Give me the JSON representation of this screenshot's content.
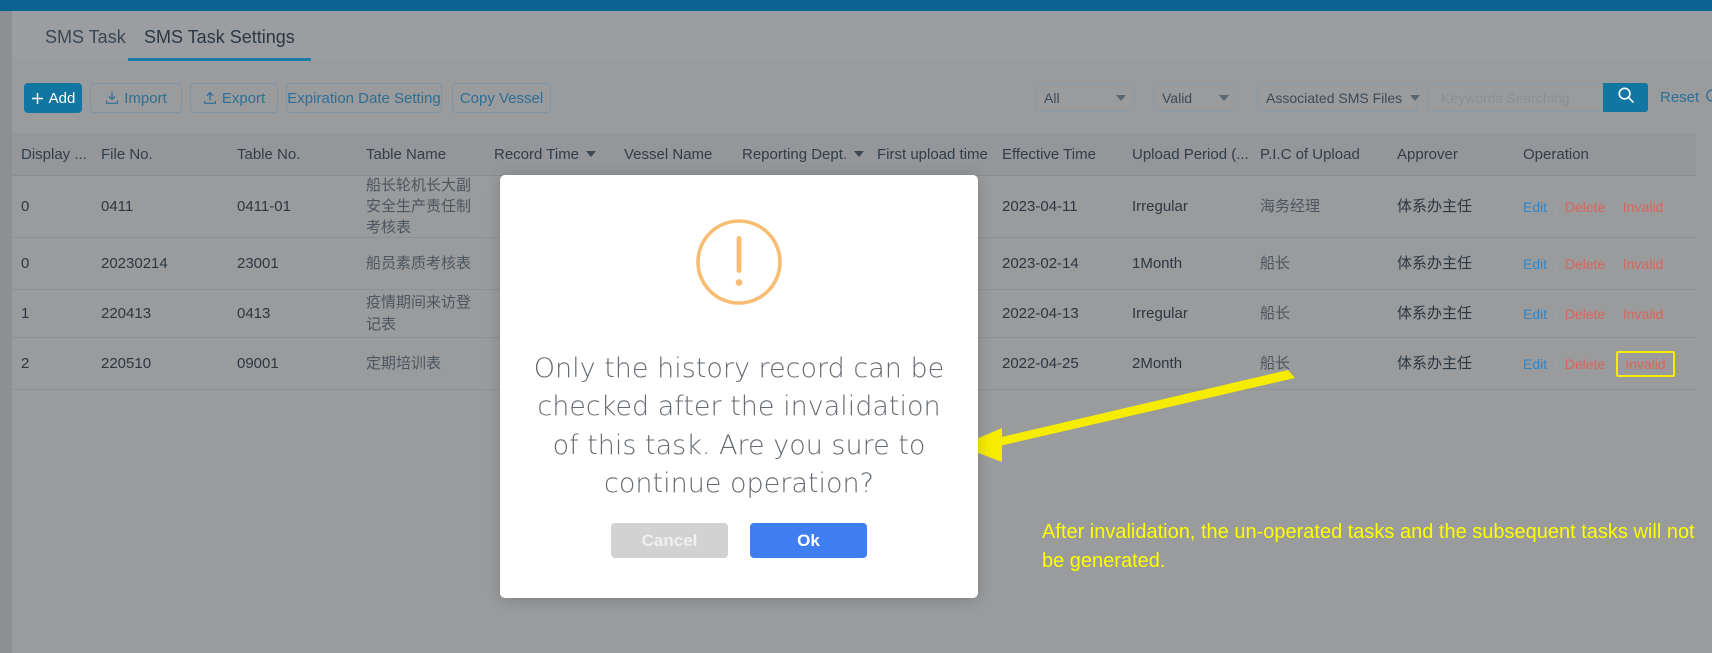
{
  "tabs": [
    {
      "label": "SMS Task",
      "active": false
    },
    {
      "label": "SMS Task Settings",
      "active": true
    }
  ],
  "toolbar": {
    "add_label": "Add",
    "import_label": "Import",
    "export_label": "Export",
    "expiration_label": "Expiration Date Setting",
    "copy_vessel_label": "Copy Vessel",
    "reset_label": "Reset"
  },
  "filters": {
    "scope": "All",
    "status": "Valid",
    "files": "Associated SMS Files"
  },
  "search": {
    "value": "",
    "placeholder": "Keywords Searching"
  },
  "table": {
    "columns": [
      "Display ...",
      "File No.",
      "Table No.",
      "Table Name",
      "Record Time",
      "Vessel Name",
      "Reporting Dept.",
      "First upload time",
      "Effective Time",
      "Upload Period (...",
      "P.I.C of Upload",
      "Approver",
      "Operation"
    ],
    "rows": [
      {
        "display": "0",
        "file_no": "0411",
        "table_no": "0411-01",
        "table_name": "船长轮机长大副安全生产责任制考核表",
        "record_time": "",
        "vessel_name": "",
        "reporting_dept": "",
        "first_upload_time": "",
        "effective_time": "2023-04-11",
        "upload_period": "Irregular",
        "pic_of_upload": "海务经理",
        "approver": "体系办主任",
        "operations": [
          "Edit",
          "Delete",
          "Invalid"
        ]
      },
      {
        "display": "0",
        "file_no": "20230214",
        "table_no": "23001",
        "table_name": "船员素质考核表",
        "record_time": "",
        "vessel_name": "",
        "reporting_dept": "",
        "first_upload_time": "",
        "effective_time": "2023-02-14",
        "upload_period": "1Month",
        "pic_of_upload": "船长",
        "approver": "体系办主任",
        "operations": [
          "Edit",
          "Delete",
          "Invalid"
        ]
      },
      {
        "display": "1",
        "file_no": "220413",
        "table_no": "0413",
        "table_name": "疫情期间来访登记表",
        "record_time": "",
        "vessel_name": "",
        "reporting_dept": "",
        "first_upload_time": "",
        "effective_time": "2022-04-13",
        "upload_period": "Irregular",
        "pic_of_upload": "船长",
        "approver": "体系办主任",
        "operations": [
          "Edit",
          "Delete",
          "Invalid"
        ]
      },
      {
        "display": "2",
        "file_no": "220510",
        "table_no": "09001",
        "table_name": "定期培训表",
        "record_time": "",
        "vessel_name": "",
        "reporting_dept": "",
        "first_upload_time": "",
        "effective_time": "2022-04-25",
        "upload_period": "2Month",
        "pic_of_upload": "船长",
        "approver": "体系办主任",
        "operations": [
          "Edit",
          "Delete",
          "Invalid"
        ],
        "highlight_operation": "Invalid"
      }
    ]
  },
  "modal": {
    "icon": "warning-exclamation-circle-icon",
    "message": "Only the history record can be checked after the invalidation of this task. Are you sure to continue operation?",
    "cancel_label": "Cancel",
    "ok_label": "Ok"
  },
  "annotation": {
    "text": "After invalidation, the un-operated tasks and the subsequent tasks will not be generated.",
    "color": "#ffff00"
  },
  "colors": {
    "accent_blue": "#1276a3",
    "top_bar": "#0a6391",
    "page_bg": "#999b9d",
    "modal_ok": "#3e7ef0",
    "warning_orange": "#f5b461",
    "link_blue": "#2e86c9",
    "danger_red": "#d9675a",
    "highlight_yellow": "#f5ec00"
  }
}
